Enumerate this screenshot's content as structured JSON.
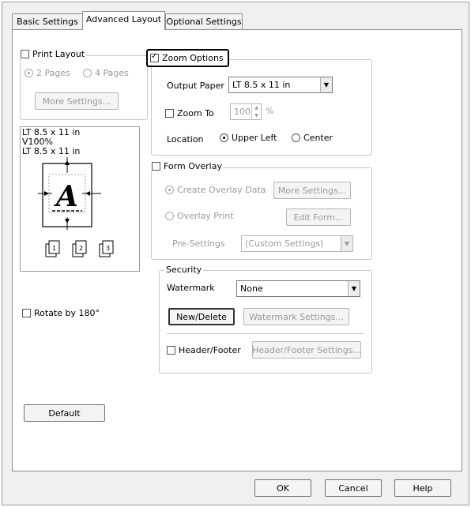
{
  "tabs": {
    "basic": "Basic Settings",
    "advanced": "Advanced Layout",
    "optional": "Optional Settings"
  },
  "print_layout": {
    "label": "Print Layout",
    "checked": false,
    "option_2pages": "2 Pages",
    "option_4pages": "4 Pages",
    "more_settings": "More Settings..."
  },
  "preview": {
    "line1": "LT 8.5 x 11 in",
    "line2": "V100%",
    "line3": "LT 8.5 x 11 in",
    "letter": "A"
  },
  "rotate": {
    "label": "Rotate by 180°",
    "checked": false
  },
  "default_button": "Default",
  "zoom": {
    "label": "Zoom Options",
    "checked": true,
    "output_paper_label": "Output Paper",
    "output_paper_value": "LT 8.5 x 11 in",
    "zoom_to_label": "Zoom To",
    "zoom_to_checked": false,
    "zoom_value": "100",
    "zoom_unit": "%",
    "location_label": "Location",
    "location_upper_left": "Upper Left",
    "location_center": "Center"
  },
  "form_overlay": {
    "label": "Form Overlay",
    "checked": false,
    "create_label": "Create Overlay Data",
    "more_settings": "More Settings...",
    "overlay_print_label": "Overlay Print",
    "edit_form": "Edit Form...",
    "pre_settings_label": "Pre-Settings",
    "pre_settings_value": "(Custom Settings)"
  },
  "security": {
    "title": "Security",
    "watermark_label": "Watermark",
    "watermark_value": "None",
    "new_delete": "New/Delete",
    "watermark_settings": "Watermark Settings...",
    "header_footer_label": "Header/Footer",
    "header_footer_checked": false,
    "header_footer_settings": "Header/Footer Settings..."
  },
  "footer": {
    "ok": "OK",
    "cancel": "Cancel",
    "help": "Help"
  },
  "colors": {
    "highlight_border": "#000000",
    "disabled_text": "#9a9a9a"
  }
}
